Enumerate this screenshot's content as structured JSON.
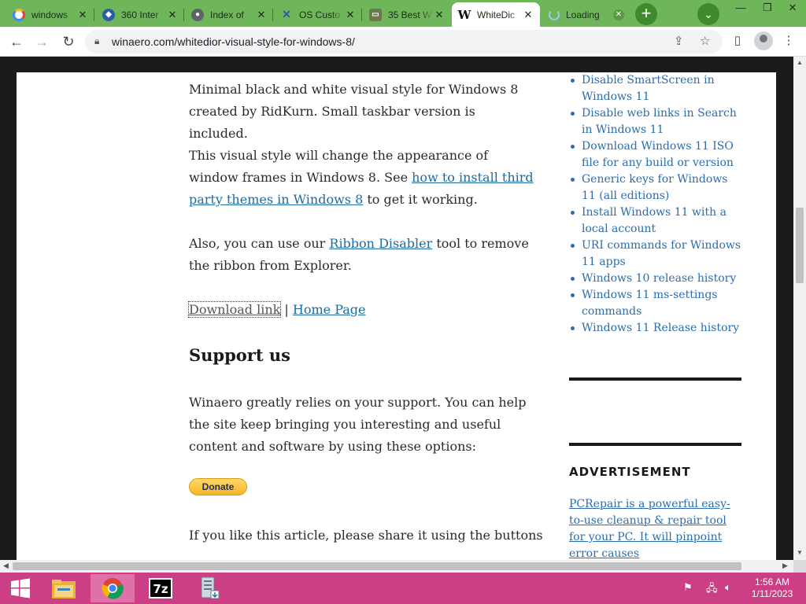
{
  "tabs": [
    {
      "label": "windows",
      "icon": "google-icon",
      "color": "#4285f4"
    },
    {
      "label": "360 Inter",
      "icon": "compass-icon",
      "color": "#2b5ca8"
    },
    {
      "label": "Index of",
      "icon": "globe-icon",
      "color": "#5f6368"
    },
    {
      "label": "OS Custo",
      "icon": "x-logo-icon",
      "color": "#2a5aa0"
    },
    {
      "label": "35 Best W",
      "icon": "monitor-icon",
      "color": "#6b7a4b"
    },
    {
      "label": "WhiteDic",
      "icon": "winaero-w-icon",
      "color": "#111111"
    },
    {
      "label": "Loading",
      "icon": "spinner-icon",
      "color": "#9ec7e6"
    }
  ],
  "address": {
    "url": "winaero.com/whitedior-visual-style-for-windows-8/"
  },
  "article": {
    "p1": "Minimal black and white visual style for Windows 8 created by RidKurn. Small taskbar version is included.",
    "p2_before": "This visual style will change the appearance of window frames in Windows 8. See ",
    "p2_link": "how to install third party themes in Windows 8",
    "p2_after": " to get it working.",
    "p3_before": "Also, you can use our ",
    "p3_link": "Ribbon Disabler",
    "p3_after": " tool to remove the ribbon from Explorer.",
    "download_link": "Download link",
    "separator": " | ",
    "home_link": "Home Page",
    "support_heading": "Support us",
    "support_text": "Winaero greatly relies on your support. You can help the site keep bringing you interesting and useful content and software by using these options:",
    "donate_label": "Donate",
    "share_text": "If you like this article, please share it using the buttons"
  },
  "sidebar": {
    "links": [
      "Disable SmartScreen in Windows 11",
      "Disable web links in Search in Windows 11",
      "Download Windows 11 ISO file for any build or version",
      "Generic keys for Windows 11 (all editions)",
      "Install Windows 11 with a local account",
      "URI commands for Windows 11 apps",
      "Windows 10 release history",
      "Windows 11 ms-settings commands",
      "Windows 11 Release history"
    ],
    "ad_title": "ADVERTISEMENT",
    "ad_text": "PCRepair is a powerful easy-to-use cleanup & repair tool for your PC. It will pinpoint error causes"
  },
  "taskbar": {
    "time": "1:56 AM",
    "date": "1/11/2023"
  }
}
